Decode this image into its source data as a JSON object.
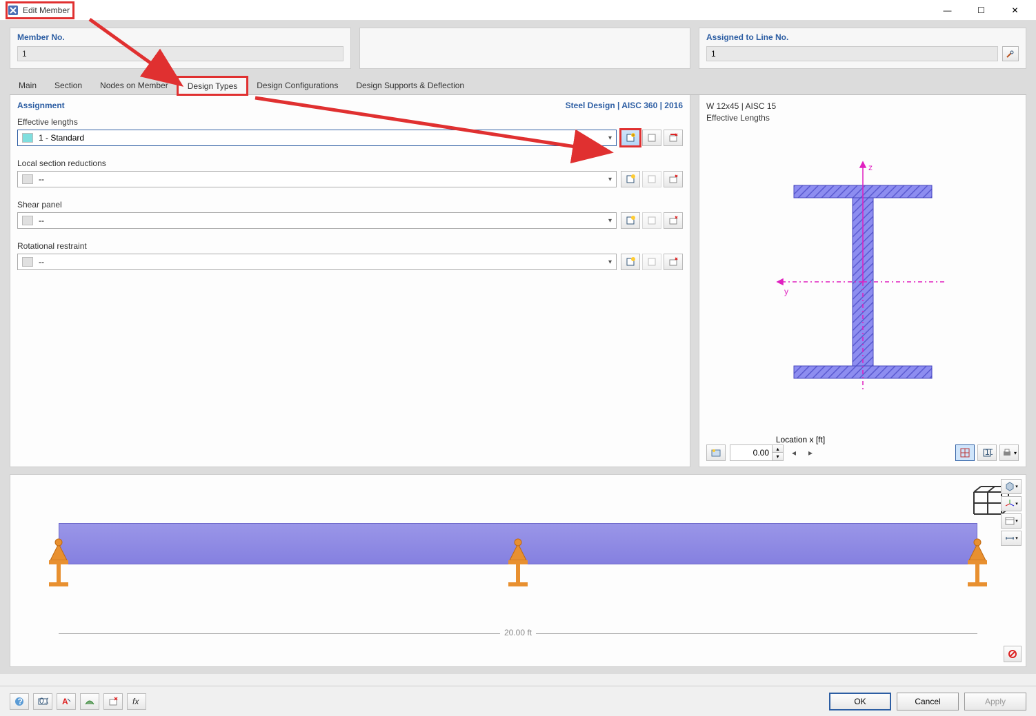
{
  "window": {
    "title": "Edit Member"
  },
  "header": {
    "member_no_label": "Member No.",
    "member_no_value": "1",
    "assigned_label": "Assigned to Line No.",
    "assigned_value": "1"
  },
  "tabs": {
    "main": "Main",
    "section": "Section",
    "nodes": "Nodes on Member",
    "design_types": "Design Types",
    "design_config": "Design Configurations",
    "design_supports": "Design Supports & Deflection"
  },
  "assignment": {
    "heading": "Assignment",
    "code": "Steel Design | AISC 360 | 2016",
    "fields": {
      "effective_lengths": {
        "label": "Effective lengths",
        "value": "1 - Standard"
      },
      "local_section_reductions": {
        "label": "Local section reductions",
        "value": "--"
      },
      "shear_panel": {
        "label": "Shear panel",
        "value": "--"
      },
      "rotational_restraint": {
        "label": "Rotational restraint",
        "value": "--"
      }
    }
  },
  "preview": {
    "section_line1": "W 12x45 | AISC 15",
    "section_line2": "Effective Lengths",
    "axis_z": "z",
    "axis_y": "y",
    "location_label": "Location x [ft]",
    "location_value": "0.00"
  },
  "view3d": {
    "dimension": "20.00 ft"
  },
  "buttons": {
    "ok": "OK",
    "cancel": "Cancel",
    "apply": "Apply"
  }
}
